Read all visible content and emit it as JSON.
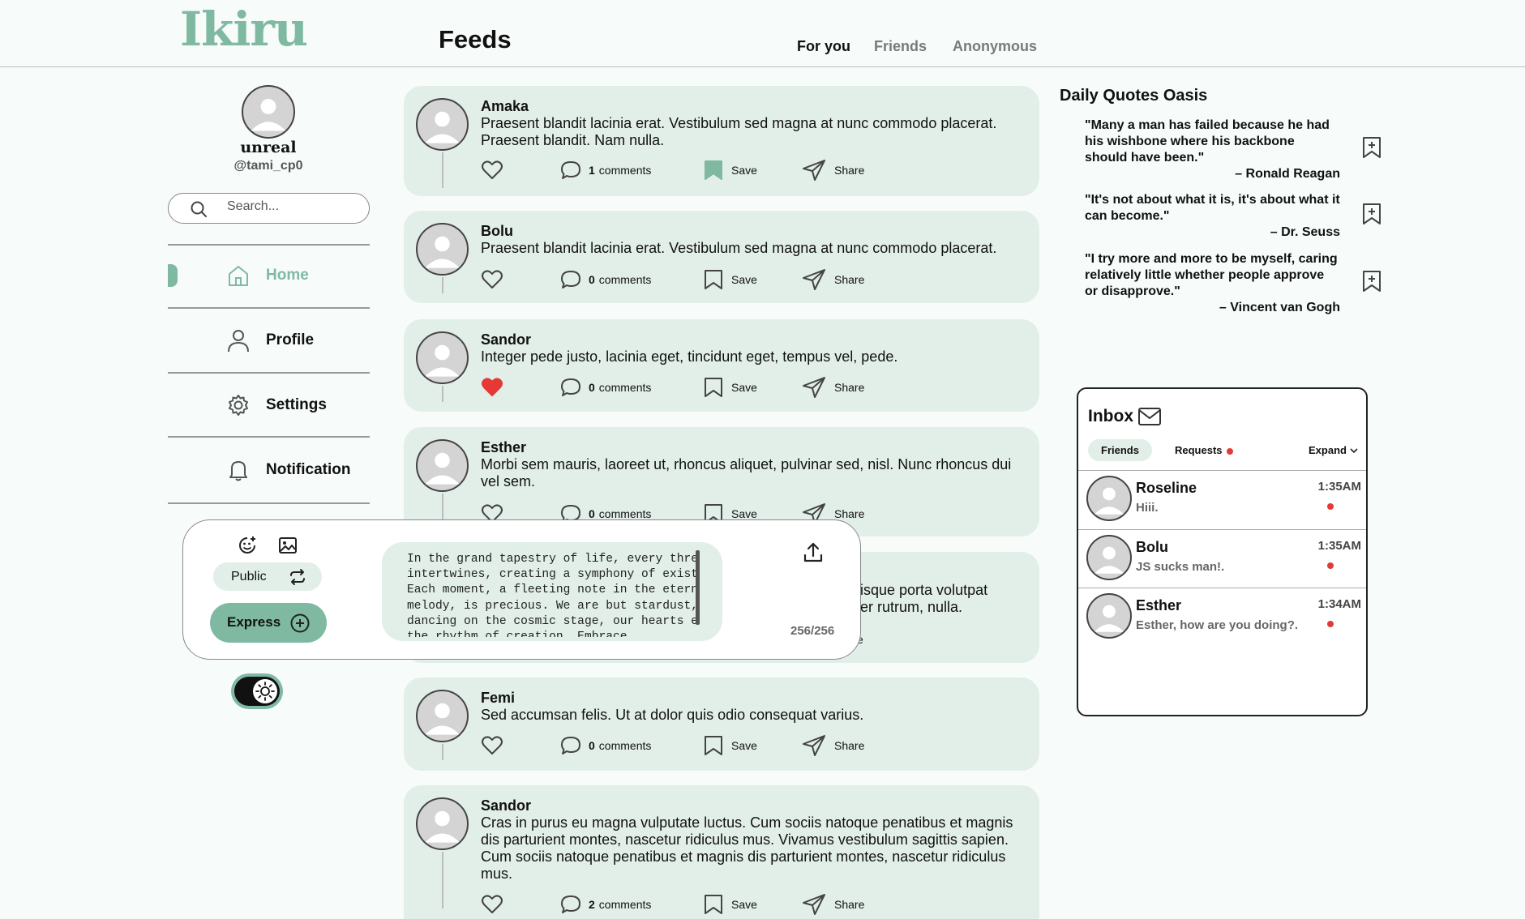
{
  "app": {
    "logo": "Ikiru",
    "page_title": "Feeds"
  },
  "tabs": [
    {
      "label": "For you",
      "active": true
    },
    {
      "label": "Friends",
      "active": false
    },
    {
      "label": "Anonymous",
      "active": false
    }
  ],
  "profile": {
    "name": "unreal",
    "handle": "@tami_cp0"
  },
  "search": {
    "placeholder": "Search..."
  },
  "nav": [
    {
      "label": "Home",
      "icon": "home-icon",
      "active": true
    },
    {
      "label": "Profile",
      "icon": "person-icon",
      "active": false
    },
    {
      "label": "Settings",
      "icon": "gear-icon",
      "active": false
    },
    {
      "label": "Notification",
      "icon": "bell-icon",
      "active": false
    }
  ],
  "posts": [
    {
      "author": "Amaka",
      "text": "Praesent blandit lacinia erat. Vestibulum sed magna at nunc commodo placerat. Praesent blandit. Nam nulla.",
      "comments": "1",
      "comments_label": "comments",
      "liked": false,
      "saved": true,
      "save_label": "Save",
      "share_label": "Share"
    },
    {
      "author": "Bolu",
      "text": "Praesent blandit lacinia erat. Vestibulum sed magna at nunc commodo placerat.",
      "comments": "0",
      "comments_label": "comments",
      "liked": false,
      "saved": false,
      "save_label": "Save",
      "share_label": "Share"
    },
    {
      "author": "Sandor",
      "text": "Integer pede justo, lacinia eget, tincidunt eget, tempus vel, pede.",
      "comments": "0",
      "comments_label": "comments",
      "liked": true,
      "saved": false,
      "save_label": "Save",
      "share_label": "Share"
    },
    {
      "author": "Esther",
      "text": "Morbi sem mauris, laoreet ut, rhoncus aliquet, pulvinar sed, nisl. Nunc rhoncus dui vel sem.",
      "comments": "0",
      "comments_label": "comments",
      "liked": false,
      "saved": false,
      "save_label": "Save",
      "share_label": "Share"
    },
    {
      "author": "",
      "text": "isque porta volutpat\ner rutrum, nulla.",
      "comments": "",
      "comments_label": "",
      "liked": false,
      "saved": false,
      "save_label": "",
      "share_label": "e"
    },
    {
      "author": "Femi",
      "text": "Sed accumsan felis. Ut at dolor quis odio consequat varius.",
      "comments": "0",
      "comments_label": "comments",
      "liked": false,
      "saved": false,
      "save_label": "Save",
      "share_label": "Share"
    },
    {
      "author": "Sandor",
      "text": "Cras in purus eu magna vulputate luctus. Cum sociis natoque penatibus et magnis dis parturient montes, nascetur ridiculus mus. Vivamus vestibulum sagittis sapien. Cum sociis natoque penatibus et magnis dis parturient montes, nascetur ridiculus mus.",
      "comments": "2",
      "comments_label": "comments",
      "liked": false,
      "saved": false,
      "save_label": "Save",
      "share_label": "Share"
    }
  ],
  "composer": {
    "visibility": "Public",
    "express_label": "Express",
    "text": "In the grand tapestry of life, every thread\nintertwines, creating a symphony of existence.\nEach moment, a fleeting note in the eternal\nmelody, is precious. We are but stardust,\ndancing on the cosmic stage, our hearts echoing\nthe rhythm of creation. Embrace",
    "char_count": "256/256"
  },
  "quotes": {
    "title": "Daily Quotes Oasis",
    "items": [
      {
        "text": "\"Many a man has failed because he had his wishbone where his backbone should have been.\"",
        "author": "– Ronald Reagan"
      },
      {
        "text": "\"It's not about what it is, it's about what it can become.\"",
        "author": "– Dr. Seuss"
      },
      {
        "text": "\"I try more and more to be myself, caring relatively little whether people approve or disapprove.\"",
        "author": "– Vincent van Gogh"
      }
    ]
  },
  "inbox": {
    "title": "Inbox",
    "tab_friends": "Friends",
    "tab_requests": "Requests",
    "expand": "Expand",
    "messages": [
      {
        "name": "Roseline",
        "text": "Hiii.",
        "time": "1:35AM"
      },
      {
        "name": "Bolu",
        "text": "JS sucks man!.",
        "time": "1:35AM"
      },
      {
        "name": "Esther",
        "text": "Esther, how are you doing?.",
        "time": "1:34AM"
      }
    ]
  },
  "colors": {
    "accent": "#7fb9a2",
    "card": "#e2efe9",
    "background": "#f7fcfb",
    "like": "#e53935",
    "unread": "#e03a3a"
  }
}
